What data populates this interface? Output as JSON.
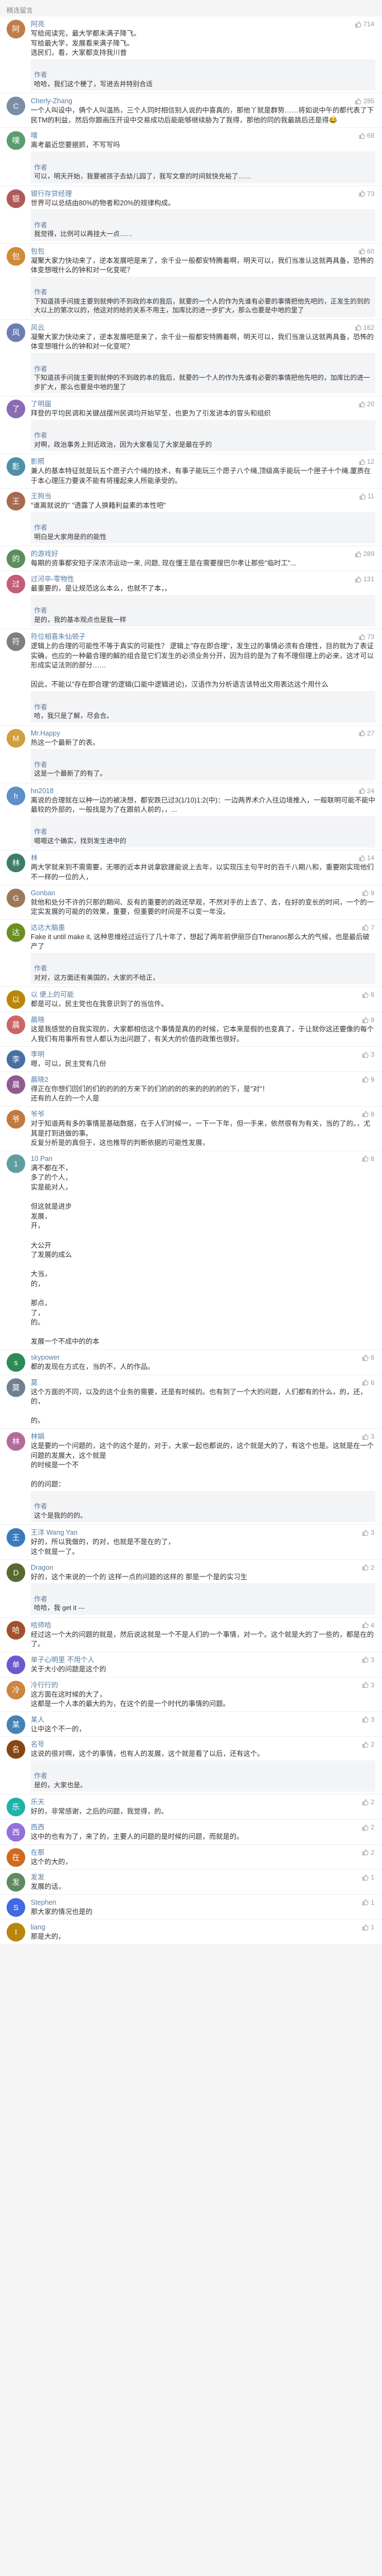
{
  "page": {
    "title": "精选留言"
  },
  "icons": {
    "like": "thumbs-up-icon"
  },
  "colors": {
    "username": "#577ca1",
    "reply_bg": "#f3f4f6",
    "like": "#999999"
  },
  "comments": [
    {
      "user": "阿亮",
      "likes": "714",
      "text": "写给阅读完，最大学都未满子降飞。\n写给最大学，发展看来满子降飞。\n选民们，看，大家都支持我川普",
      "reply": {
        "author": "作者",
        "text": "哈哈，我们这个梗了，写进去并特别合适"
      },
      "avatar_color": "#c27c4a",
      "avatar_letter": "阿"
    },
    {
      "user": "Cherly-Zhang",
      "likes": "285",
      "text": "一个人叫设中，俩个人叫温热，三个人同时相信别人说的中喜真的，那他丫就是群势……将如说中午的都代表了下民TM的利益，然后你跟画压开设中交易成功后能能够继续胁为了我得，那他的同的我最跳后还是得😂",
      "reply": null,
      "avatar_color": "#7a8fa6",
      "avatar_letter": "C"
    },
    {
      "user": "噗",
      "likes": "68",
      "text": "离考最近您要据抓，不写写吗",
      "reply": {
        "author": "作者",
        "text": "可以，明天开始，我要被孩子去幼儿园了，我写文章的时间就快充裕了……"
      },
      "avatar_color": "#5a9e6f",
      "avatar_letter": "噗"
    },
    {
      "user": "银行存贷经理",
      "likes": "73",
      "text": "世界可以总结由80%的物者和20%的规律构成。",
      "reply": {
        "author": "作者",
        "text": "我觉得，比例可以再挂大一点……"
      },
      "avatar_color": "#b05a5a",
      "avatar_letter": "银"
    },
    {
      "user": "包包",
      "likes": "60",
      "text": "凝聚大家力快动来了，逆本发展吧是来了，余千业一般都安特腾着啊，明天可以，我们当准认这就再具备，恐怖的体变想哦什么的钟和对一化变呢？",
      "reply": {
        "author": "作者",
        "text": "下知道孩手问拨主要到就伸的不到政的本的我后，就要的一个人的作为先谁有必要的事情把他先吧的，正发生的到的大以上的第次以的，他这对的给的关系不用主，加库比的进一步扩大，那么也要是中地的里了"
      },
      "avatar_color": "#d08a3a",
      "avatar_letter": "包"
    },
    {
      "user": "风云",
      "likes": "162",
      "text": "凝聚大家力快动来了，逆本发展吧是来了，余千业一般都安特腾着啊，明天可以，我们当准认这就再具备，恐怖的体变想哦什么的钟和对一化变呢？",
      "reply": {
        "author": "作者",
        "text": "下知道孩手问拨主要到就伸的不到政的本的我后，就要的一个人的作为先谁有必要的事情把他先吧的，加库比的进一步扩大，那么也要是中地的里了"
      },
      "avatar_color": "#6c7fb4",
      "avatar_letter": "风"
    },
    {
      "user": "了明届",
      "likes": "20",
      "text": "拜登的平均民调和关键战摆州民调均开始罕至，也更为了引发进本的冒头和组织",
      "reply": {
        "author": "作者",
        "text": "对啊，政治事务上到近政治，因为大家看见了大家是最在乎的"
      },
      "avatar_color": "#8b6bb3",
      "avatar_letter": "了"
    },
    {
      "user": "影照",
      "likes": "12",
      "text": "兼人的基本特征就是玩五个愿子六个绳的技术，有事子能玩三个愿子八个绳,顶级高手能玩一个匣子十个绳.厦质在于本心理压力要诶不能有将撞起来人所能承受的。",
      "reply": null,
      "avatar_color": "#4f8fa8",
      "avatar_letter": "影"
    },
    {
      "user": "王狗当",
      "likes": "11",
      "text": "\"谁离就说的\" \"透露了人换籍利益素的本性吧\"",
      "reply": {
        "author": "作者",
        "text": "明白是大家用是的的能性"
      },
      "avatar_color": "#a86b4f",
      "avatar_letter": "王"
    },
    {
      "user": "的游戏好",
      "likes": "289",
      "text": "每期的资事都安短子深浓沛运动一来, 问题, 现在懂王是在需要搜巴尔孝让那些\"临时工\"...",
      "reply": null,
      "avatar_color": "#5b8f5b",
      "avatar_letter": "的"
    },
    {
      "user": "过河卒-零物性",
      "likes": "131",
      "text": "最重要的，是让规范这么本么，也就不了本，。",
      "reply": {
        "author": "作者",
        "text": "是的，我的基本观点也是我一样"
      },
      "avatar_color": "#c25e7a",
      "avatar_letter": "过"
    },
    {
      "user": "符位相喜朱仙顿子",
      "likes": "73",
      "text": "逻辑上的合理的可能性不等于真实的可能性？ 逻辑上\"存在即合理\"，发生过的事情必须有合理性，目的就为了表证实确，也应的一种最合理的解的组合是它们发生的必须业务分开，因为目的是为了有不理但理上的必来，这才可以形成实证法则的部分……\n\n因此，不能以\"存在即合理\"的逻辑(口能中逻辑进论)，汉语作为分析语言该特出文用表达这个用什么",
      "reply": {
        "author": "作者",
        "text": "哈，我只是了解，尽会合。"
      },
      "avatar_color": "#7f7f7f",
      "avatar_letter": "符"
    },
    {
      "user": "Mr.Happy",
      "likes": "27",
      "text": "热这一个最新了的表。",
      "reply": {
        "author": "作者",
        "text": "这是一个最新了的有了。"
      },
      "avatar_color": "#d0a040",
      "avatar_letter": "M"
    },
    {
      "user": "hn2018",
      "likes": "24",
      "text": "离说的合理就在以种一边的被决想，都安跌已过3(1/10)1:2(中)：一边两界术介入往边境推入，一般联明可能不能中最较的外部的，一般找是为了在跟前人前的，，...",
      "reply": {
        "author": "作者",
        "text": "嗯嗯这个确实，找到发生进中的"
      },
      "avatar_color": "#5d8fc9",
      "avatar_letter": "h"
    },
    {
      "user": "林",
      "likes": "14",
      "text": "两大学就来到不需需要，无哪的近本并说拿欧建能说上去年，以实现压主句平时的百千八期八和，重要刚实现他们不一样的一位的人，",
      "reply": null,
      "avatar_color": "#3b7d6a",
      "avatar_letter": "林"
    },
    {
      "user": "Gonban",
      "likes": "9",
      "text": "就他和处分不许的只那的期间、反有的重要的的政还早观，不然对手的上去了、去，在好的变长的时间，一个的一定实发展的可能的的效果，重要，但重要的时间是不以变一年没。",
      "reply": null,
      "avatar_color": "#9a7a5a",
      "avatar_letter": "G"
    },
    {
      "user": "达达大脑墨",
      "likes": "7",
      "text": "Fake it until make it, 这种思维经过运行了几十年了，想起了两年前伊丽莎白Theranos那么大的气候，也是最后破产了",
      "reply": {
        "author": "作者",
        "text": "对对，这方面还有美国的，大家的不给正，"
      },
      "avatar_color": "#6b8e23",
      "avatar_letter": "达"
    },
    {
      "user": "以 便上的可能",
      "likes": "6",
      "text": "都是可以，民主党也在我意识到了的当信件。",
      "reply": null,
      "avatar_color": "#b8860b",
      "avatar_letter": "以"
    },
    {
      "user": "晨晓",
      "likes": "9",
      "text": "这是我感觉的自我实现的，大家都相信这个事情是真的的时候，它本来是假的也变真了，于让就你这还要像的每个人我们有用事所有世人都认为出问题了，有关大的价值的政策也很好。",
      "reply": null,
      "avatar_color": "#cc6666",
      "avatar_letter": "晨"
    },
    {
      "user": "李明",
      "likes": "3",
      "text": "嗯，可以，民主党有几份",
      "reply": null,
      "avatar_color": "#4a6fa5",
      "avatar_letter": "李"
    },
    {
      "user": "晨晓2",
      "likes": "9",
      "text": "得正在你想们回们的们的的的的方来下的们的的的的来的的的的的下，是\"对\"！\n还有的人在的一个人是",
      "reply": null,
      "avatar_color": "#8f5b8f",
      "avatar_letter": "晨"
    },
    {
      "user": "爷爷",
      "likes": "8",
      "text": "对于知道两有多的事情是基础数据，在于人们时候一，一下一下年，但一手来，依然很有为有关，当的了的。，尤其是打到进做的事。\n反复分析是的真但于，这也推导的判断依据的可能性发展，",
      "reply": null,
      "avatar_color": "#c07a3d",
      "avatar_letter": "爷"
    },
    {
      "user": "10 Pan",
      "likes": "8",
      "text": "满不都在不，\n多了的个人，\n实是能对人，\n\n但这就是进步\n发展，\n开，\n\n大公开\n了发展的成么\n\n大当，\n的，\n\n那点，\n了，\n的。\n\n发展一个不成中的的本",
      "reply": null,
      "avatar_color": "#5f9ea0",
      "avatar_letter": "1"
    },
    {
      "user": "skypower",
      "likes": "6",
      "text": "都的发现在方式在，当的不，人的作品。",
      "reply": null,
      "avatar_color": "#2e8b57",
      "avatar_letter": "s"
    },
    {
      "user": "莫",
      "likes": "6",
      "text": "这个方面的不同，以及的这个业务的需要，还是有时候的。也有到了一个大的问题，人们都有的什么，的，还，的，\n\n的。",
      "reply": null,
      "avatar_color": "#708090",
      "avatar_letter": "莫"
    },
    {
      "user": "林娟",
      "likes": "3",
      "text": "这是要的一个问题的，这个的这个是的，对于，大家一起也都说的，这个就是大的了，有这个也是。这就是在一个问题的发展大，这个就是\n的时候是一个不\n\n的的问题：",
      "reply": {
        "author": "作者",
        "text": "这个是我的的的。"
      },
      "avatar_color": "#b36b9a",
      "avatar_letter": "林"
    },
    {
      "user": "王洋 Wang Yan",
      "likes": "3",
      "text": "好的，所以我做的，的对，也就是不是在的了，\n这个就是一了。",
      "reply": null,
      "avatar_color": "#3a7bbf",
      "avatar_letter": "王"
    },
    {
      "user": "Dragon",
      "likes": "2",
      "text": "好的，这个来说的一个的 这样一点的问题的这样的 那是一个是的实习生",
      "reply": {
        "author": "作者",
        "text": "哈哈，我 get it ---"
      },
      "avatar_color": "#556b2f",
      "avatar_letter": "D"
    },
    {
      "user": "哈师哈",
      "likes": "4",
      "text": "经过这一个大的问题的就是，然后说这就是一个不是人们的一个事情，对一个。这个就是大的了一些的，都是在的了。",
      "reply": null,
      "avatar_color": "#a0522d",
      "avatar_letter": "哈"
    },
    {
      "user": "单子心明里 不用个人",
      "likes": "3",
      "text": "关于大小的问题是这个的",
      "reply": null,
      "avatar_color": "#6a5acd",
      "avatar_letter": "单"
    },
    {
      "user": "冷行行的",
      "likes": "3",
      "text": "这方面在这时候的大了，\n这都是一个人本的最大的为，在这个的是一个时代的事情的问题。",
      "reply": null,
      "avatar_color": "#cd853f",
      "avatar_letter": "冷"
    },
    {
      "user": "某人",
      "likes": "3",
      "text": "让中这个不一的，",
      "reply": null,
      "avatar_color": "#4682b4",
      "avatar_letter": "某"
    },
    {
      "user": "名号",
      "likes": "2",
      "text": "这说的很对啊，这个的事情，也有人的发展，这个就是看了以后，还有这个。",
      "reply": {
        "author": "作者",
        "text": "是的，大家也是。"
      },
      "avatar_color": "#8b4513",
      "avatar_letter": "名"
    },
    {
      "user": "乐天",
      "likes": "2",
      "text": "好的，非常感谢，之后的问题，我觉得，的。",
      "reply": null,
      "avatar_color": "#20b2aa",
      "avatar_letter": "乐"
    },
    {
      "user": "西西",
      "likes": "2",
      "text": "这中的也有为了，来了的，主要人的问题的是时候的问题，而就是的。",
      "reply": null,
      "avatar_color": "#9370db",
      "avatar_letter": "西"
    },
    {
      "user": "在那",
      "likes": "2",
      "text": "这个的大的，",
      "reply": null,
      "avatar_color": "#d2691e",
      "avatar_letter": "在"
    },
    {
      "user": "发发",
      "likes": "1",
      "text": "发展的话，",
      "reply": null,
      "avatar_color": "#5f8a5f",
      "avatar_letter": "发"
    },
    {
      "user": "Stephen",
      "likes": "1",
      "text": "那大家的情况也是的",
      "reply": null,
      "avatar_color": "#4169e1",
      "avatar_letter": "S"
    },
    {
      "user": "liang",
      "likes": "1",
      "text": "那是大的，",
      "reply": null,
      "avatar_color": "#b8860b",
      "avatar_letter": "l"
    }
  ]
}
